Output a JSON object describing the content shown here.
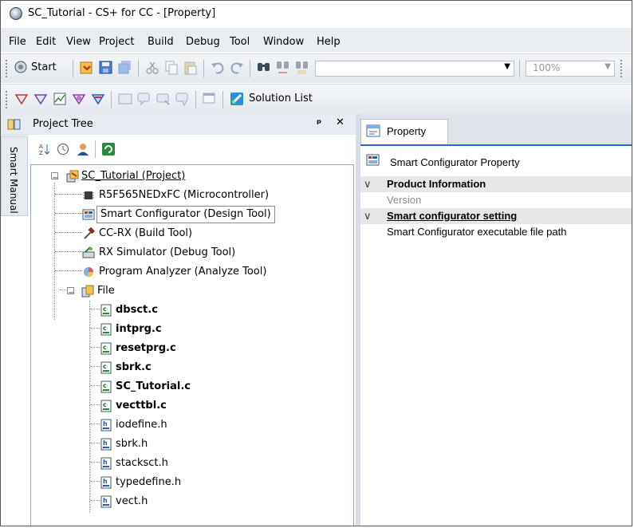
{
  "window": {
    "title": "SC_Tutorial - CS+ for CC - [Property]"
  },
  "menu": [
    "File",
    "Edit",
    "View",
    "Project",
    "Build",
    "Debug",
    "Tool",
    "Window",
    "Help"
  ],
  "toolbar1": {
    "start_label": "Start",
    "zoom_value": "100%"
  },
  "toolbar2": {
    "solution_list_label": "Solution List"
  },
  "side_tab": {
    "label": "Smart Manual"
  },
  "project_tree": {
    "title": "Project Tree",
    "pin_glyph": "ᵖ",
    "close_glyph": "✕",
    "project": "SC_Tutorial (Project)",
    "nodes": [
      "R5F565NEDxFC (Microcontroller)",
      "Smart Configurator (Design Tool)",
      "CC-RX (Build Tool)",
      "RX Simulator (Debug Tool)",
      "Program Analyzer (Analyze Tool)"
    ],
    "file_folder": "File",
    "files_bold": [
      "dbsct.c",
      "intprg.c",
      "resetprg.c",
      "sbrk.c",
      "SC_Tutorial.c",
      "vecttbl.c"
    ],
    "files_regular": [
      "iodefine.h",
      "sbrk.h",
      "stacksct.h",
      "typedefine.h",
      "vect.h"
    ]
  },
  "property": {
    "tab_label": "Property",
    "header": "Smart Configurator Property",
    "rows": {
      "cat1": "Product Information",
      "item1": "Version",
      "cat2": "Smart configurator setting",
      "item2": "Smart Configurator executable file path"
    }
  },
  "colors": {
    "accent": "#2f64d6",
    "selection_border": "#8c8c8c"
  }
}
